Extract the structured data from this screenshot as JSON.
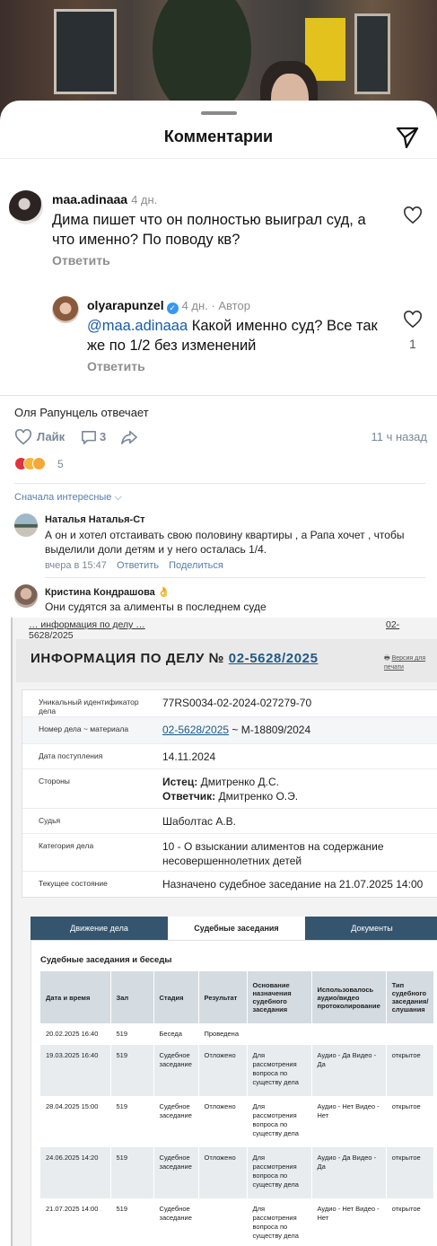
{
  "instagram": {
    "title": "Комментарии",
    "comments": [
      {
        "username": "maa.adinaaa",
        "time": "4 дн.",
        "text": "Дима пишет что он полностью выиграл суд, а что именно? По поводу кв?",
        "reply_label": "Ответить"
      },
      {
        "username": "olyarapunzel",
        "time": "4 дн. · Автор",
        "mention": "@maa.adinaaa",
        "text": " Какой именно суд? Все так же по 1/2 без изменений",
        "reply_label": "Ответить",
        "likes": "1"
      }
    ]
  },
  "vk": {
    "author_line": "Оля Рапунцель отвечает",
    "like_label": "Лайк",
    "comment_count": "3",
    "time_ago": "11 ч назад",
    "reactions_count": "5",
    "sort_label": "Сначала интересные",
    "comments": [
      {
        "name": "Наталья Наталья-Ст",
        "text": "А он и хотел отстаивать свою половину квартиры , а Рапа хочет , чтобы выделили доли детям и у него осталась 1/4.",
        "time": "вчера в 15:47",
        "reply": "Ответить",
        "share": "Поделиться"
      },
      {
        "name": "Кристина Кондрашова 👌",
        "text": "Они судятся за алименты в последнем суде"
      }
    ]
  },
  "court": {
    "breadcrumb_line1": "… информация по делу …",
    "breadcrumb_num": "02-",
    "breadcrumb_line2": "5628/2025",
    "title_prefix": "ИНФОРМАЦИЯ ПО ДЕЛУ №",
    "case_number": "02-5628/2025",
    "print_label": "Версия для печати",
    "info": [
      {
        "label": "Уникальный идентификатор дела",
        "value": "77RS0034-02-2024-027279-70"
      },
      {
        "label": "Номер дела ~ материала",
        "link": "02-5628/2025",
        "value": " ~ М-18809/2024"
      },
      {
        "label": "Дата поступления",
        "value": "14.11.2024"
      },
      {
        "label": "Стороны",
        "plaintiff_label": "Истец:",
        "plaintiff": " Дмитренко Д.С.",
        "defendant_label": "Ответчик:",
        "defendant": " Дмитренко О.Э."
      },
      {
        "label": "Судья",
        "value": "Шаболтас А.В."
      },
      {
        "label": "Категория дела",
        "value": "10 - О взыскании алиментов на содержание несовершеннолетних детей"
      },
      {
        "label": "Текущее состояние",
        "value": "Назначено судебное заседание на 21.07.2025 14:00"
      }
    ],
    "tabs": [
      "Движение дела",
      "Судебные заседания",
      "Документы"
    ],
    "hearings_title": "Судебные заседания и беседы",
    "columns": [
      "Дата и время",
      "Зал",
      "Стадия",
      "Результат",
      "Основание назначения судебного заседания",
      "Использовалось аудио/видео протоколирование",
      "Тип судебного заседания/ слушания"
    ],
    "rows": [
      [
        "20.02.2025 16:40",
        "519",
        "Беседа",
        "Проведена",
        "",
        "",
        ""
      ],
      [
        "19.03.2025 16:40",
        "519",
        "Судебное заседание",
        "Отложено",
        "Для рассмотрения вопроса по существу дела",
        "Аудио - Да Видео - Да",
        "открытое"
      ],
      [
        "28.04.2025 15:00",
        "519",
        "Судебное заседание",
        "Отложено",
        "Для рассмотрения вопроса по существу дела",
        "Аудио - Нет Видео - Нет",
        "открытое"
      ],
      [
        "24.06.2025 14:20",
        "519",
        "Судебное заседание",
        "Отложено",
        "Для рассмотрения вопроса по существу дела",
        "Аудио - Да Видео - Да",
        "открытое"
      ],
      [
        "21.07.2025 14:00",
        "519",
        "Судебное заседание",
        "",
        "Для рассмотрения вопроса по существу дела",
        "Аудио - Нет Видео - Нет",
        "открытое"
      ]
    ]
  },
  "colors": {
    "mention": "#1a5ba6",
    "court_link": "#1e5a87",
    "tab_bar": "#35546e",
    "vk_link": "#5a7ea8"
  }
}
